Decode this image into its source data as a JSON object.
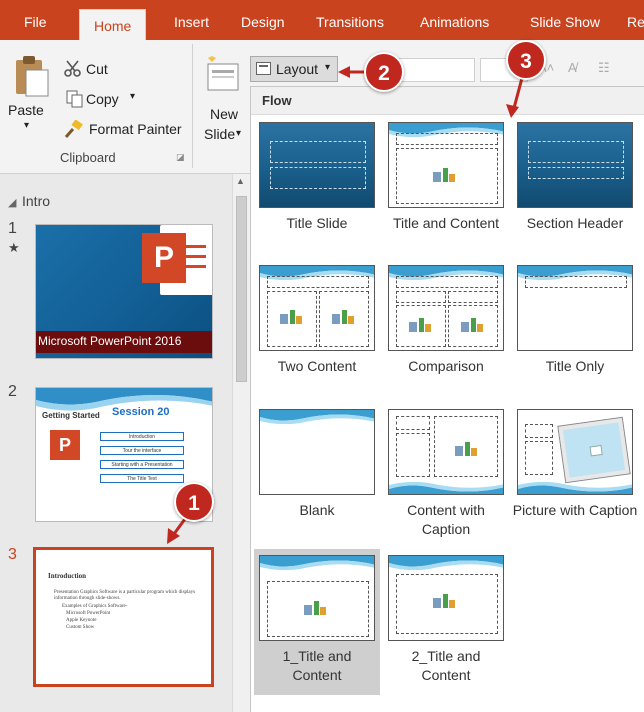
{
  "tabs": [
    "File",
    "Home",
    "Insert",
    "Design",
    "Transitions",
    "Animations",
    "Slide Show",
    "Re"
  ],
  "clipboard": {
    "paste": "Paste",
    "cut": "Cut",
    "copy": "Copy",
    "format_painter": "Format Painter",
    "group_label": "Clipboard"
  },
  "slides_group": {
    "new_slide_line1": "New",
    "new_slide_line2": "Slide",
    "layout": "Layout"
  },
  "section": {
    "name": "Intro"
  },
  "slides": [
    {
      "number": "1",
      "star": "★",
      "caption": "Microsoft PowerPoint 2016"
    },
    {
      "number": "2",
      "title": "Getting Started",
      "session": "Session 20",
      "items": [
        "Introduction",
        "Tour the interface",
        "Starting with a Presentation",
        "The Title Text"
      ]
    },
    {
      "number": "3",
      "title": "Introduction",
      "bullet_main": "Presentation Graphics Software is a particular program which displays information through slide-shows.",
      "bullets": [
        "Examples of Graphics Software-",
        "Microsoft PowerPoint",
        "Apple Keynote",
        "Custom Show"
      ]
    }
  ],
  "gallery": {
    "title": "Flow",
    "layouts": [
      {
        "label": "Title Slide"
      },
      {
        "label": "Title and Content"
      },
      {
        "label": "Section Header"
      },
      {
        "label": "Two Content"
      },
      {
        "label": "Comparison"
      },
      {
        "label": "Title Only"
      },
      {
        "label": "Blank"
      },
      {
        "label": "Content with Caption"
      },
      {
        "label": "Picture with Caption"
      },
      {
        "label": "1_Title and Content"
      },
      {
        "label": "2_Title and Content"
      }
    ]
  },
  "callouts": [
    "1",
    "2",
    "3"
  ],
  "colors": {
    "accent": "#c9431f",
    "callout": "#c0281f"
  }
}
